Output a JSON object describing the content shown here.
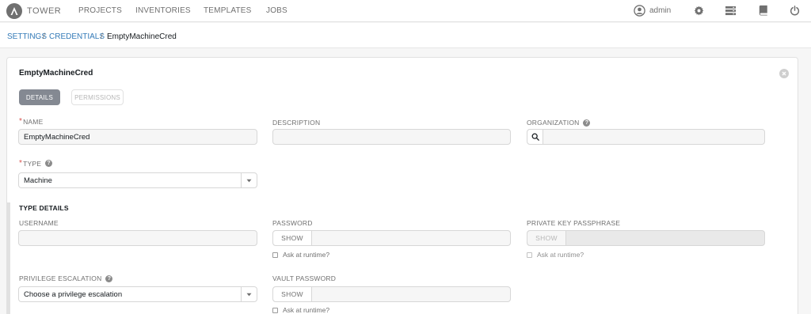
{
  "nav": {
    "brand": "TOWER",
    "links": [
      "PROJECTS",
      "INVENTORIES",
      "TEMPLATES",
      "JOBS"
    ],
    "user": "admin"
  },
  "breadcrumb": {
    "settings": "SETTINGS",
    "sep1": "/",
    "credentials": "CREDENTIALS",
    "sep2": "/",
    "current": "EmptyMachineCred"
  },
  "panel": {
    "title": "EmptyMachineCred",
    "tabs": {
      "details": "DETAILS",
      "permissions": "PERMISSIONS"
    }
  },
  "form": {
    "name": {
      "required_mark": "*",
      "label": "NAME",
      "value": "EmptyMachineCred"
    },
    "description": {
      "label": "DESCRIPTION",
      "value": ""
    },
    "organization": {
      "label": "ORGANIZATION",
      "value": ""
    },
    "type": {
      "required_mark": "*",
      "label": "TYPE",
      "value": "Machine"
    },
    "type_details": {
      "title": "TYPE DETAILS",
      "username": {
        "label": "USERNAME",
        "value": ""
      },
      "password": {
        "label": "PASSWORD",
        "show": "SHOW",
        "ask": "Ask at runtime?"
      },
      "private_key_passphrase": {
        "label": "PRIVATE KEY PASSPHRASE",
        "show": "SHOW",
        "ask": "Ask at runtime?"
      },
      "privilege_escalation": {
        "label": "PRIVILEGE ESCALATION",
        "value": "Choose a privilege escalation"
      },
      "vault_password": {
        "label": "VAULT PASSWORD",
        "show": "SHOW",
        "ask": "Ask at runtime?"
      }
    }
  },
  "help_glyph": "?",
  "colors": {
    "accent_link": "#337ab7",
    "tab_active": "#848992",
    "required": "#d9534f"
  },
  "icons": [
    "tower-logo-icon",
    "user-icon",
    "gear-icon",
    "list-icon",
    "book-icon",
    "power-icon",
    "close-icon",
    "search-icon",
    "caret-down-icon",
    "help-icon",
    "checkbox-icon"
  ]
}
